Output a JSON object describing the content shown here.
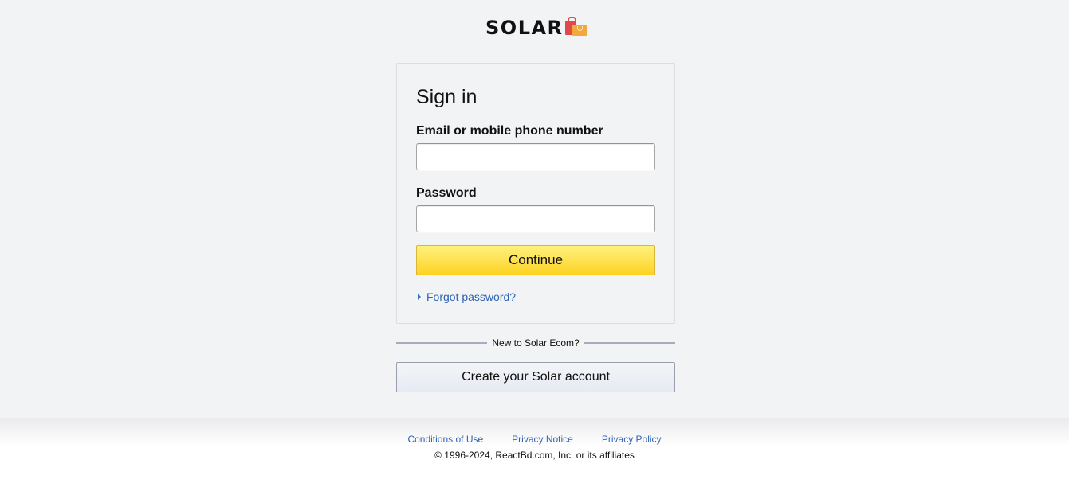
{
  "header": {
    "logo_text": "SOLAR",
    "logo_icon": "shopping-bags-icon"
  },
  "signin": {
    "title": "Sign in",
    "email_label": "Email or mobile phone number",
    "email_value": "",
    "password_label": "Password",
    "password_value": "",
    "continue_label": "Continue",
    "forgot_label": "Forgot password?",
    "forgot_icon": "caret-right-icon"
  },
  "divider": {
    "text": "New to Solar Ecom?"
  },
  "create_account": {
    "label": "Create your Solar account"
  },
  "footer": {
    "links": [
      "Conditions of Use",
      "Privacy Notice",
      "Privacy Policy"
    ],
    "copyright": "© 1996-2024, ReactBd.com, Inc. or its affiliates"
  },
  "colors": {
    "background": "#f2f3f4",
    "continue_button": "#fed21f",
    "link": "#2e63b4"
  }
}
